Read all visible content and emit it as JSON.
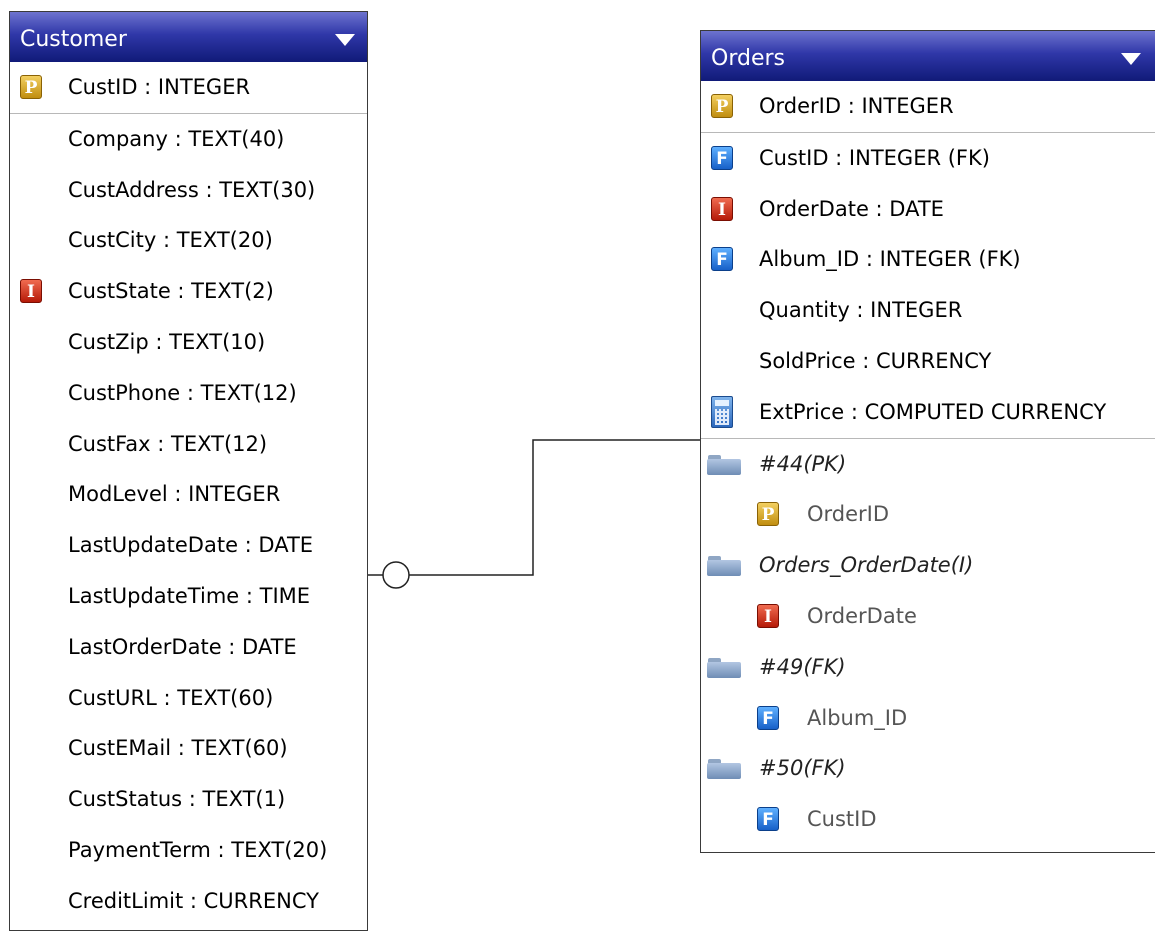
{
  "customer": {
    "title": "Customer",
    "rows": [
      {
        "label": "CustID : INTEGER",
        "icon": "primary-key-icon"
      },
      {
        "label": "Company : TEXT(40)"
      },
      {
        "label": "CustAddress : TEXT(30)"
      },
      {
        "label": "CustCity : TEXT(20)"
      },
      {
        "label": "CustState : TEXT(2)",
        "icon": "index-icon"
      },
      {
        "label": "CustZip : TEXT(10)"
      },
      {
        "label": "CustPhone : TEXT(12)"
      },
      {
        "label": "CustFax : TEXT(12)"
      },
      {
        "label": "ModLevel : INTEGER"
      },
      {
        "label": "LastUpdateDate : DATE"
      },
      {
        "label": "LastUpdateTime : TIME"
      },
      {
        "label": "LastOrderDate : DATE"
      },
      {
        "label": "CustURL : TEXT(60)"
      },
      {
        "label": "CustEMail : TEXT(60)"
      },
      {
        "label": "CustStatus : TEXT(1)"
      },
      {
        "label": "PaymentTerm : TEXT(20)"
      },
      {
        "label": "CreditLimit : CURRENCY"
      }
    ]
  },
  "orders": {
    "title": "Orders",
    "rows": [
      {
        "label": "OrderID : INTEGER",
        "icon": "primary-key-icon"
      },
      {
        "label": "CustID : INTEGER (FK)",
        "icon": "foreign-key-icon"
      },
      {
        "label": "OrderDate : DATE",
        "icon": "index-icon"
      },
      {
        "label": "Album_ID : INTEGER (FK)",
        "icon": "foreign-key-icon"
      },
      {
        "label": "Quantity : INTEGER"
      },
      {
        "label": "SoldPrice : CURRENCY"
      },
      {
        "label": "ExtPrice : COMPUTED CURRENCY",
        "icon": "calculator-icon"
      }
    ],
    "indexes": [
      {
        "name": "#44(PK)",
        "column": "OrderID",
        "column_icon": "primary-key-icon"
      },
      {
        "name": "Orders_OrderDate(I)",
        "column": "OrderDate",
        "column_icon": "index-icon"
      },
      {
        "name": "#49(FK)",
        "column": "Album_ID",
        "column_icon": "foreign-key-icon"
      },
      {
        "name": "#50(FK)",
        "column": "CustID",
        "column_icon": "foreign-key-icon"
      }
    ]
  },
  "relationship": {
    "from": "Customer",
    "to": "Orders",
    "notation": "zero-or-one"
  },
  "key_letters": {
    "primary": "P",
    "foreign": "F",
    "index": "I"
  }
}
